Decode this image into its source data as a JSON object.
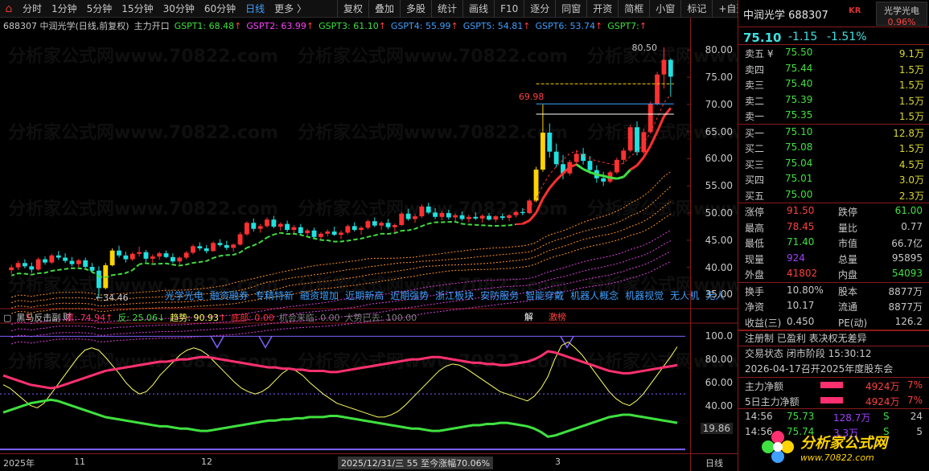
{
  "toolbar": {
    "periods": [
      "分时",
      "1分钟",
      "5分钟",
      "15分钟",
      "30分钟",
      "60分钟",
      "日线",
      "更多 〉"
    ],
    "active_period": "日线",
    "tools": [
      "复权",
      "叠加",
      "多股",
      "统计",
      "画线",
      "F10",
      "逐分",
      "同窗",
      "开资",
      "简框",
      "小窗",
      "标记",
      "+自选",
      "返回"
    ]
  },
  "legend_main": {
    "stock": "688307 中润光学(日线,前复权)",
    "indicator": "主力开口",
    "gspt": [
      {
        "label": "GSPT1: 68.48",
        "color": "#3fe03f",
        "arrow": "↑"
      },
      {
        "label": "GSPT2: 63.99",
        "color": "#ff40ff",
        "arrow": "↑"
      },
      {
        "label": "GSPT3: 61.10",
        "color": "#3fe03f",
        "arrow": "↑"
      },
      {
        "label": "GSPT4: 55.99",
        "color": "#3fa0ff",
        "arrow": "↑"
      },
      {
        "label": "GSPT5: 54.81",
        "color": "#3fa0ff",
        "arrow": "↑"
      },
      {
        "label": "GSPT6: 53.74",
        "color": "#3fa0ff",
        "arrow": "↑"
      },
      {
        "label": "GSPT7:",
        "color": "#3fe03f",
        "arrow": "↑"
      }
    ]
  },
  "legend_sub": {
    "name": "黑马反击副",
    "items": [
      {
        "label": "黑: 74.94",
        "color": "#ff3070",
        "arrow": "↑"
      },
      {
        "label": "反: 25.06",
        "color": "#3fe03f",
        "arrow": "↓"
      },
      {
        "label": "趋势: 90.93",
        "color": "#ffff60",
        "arrow": "↑"
      },
      {
        "label": "底部: 0.00",
        "color": "#ff3030",
        "arrow": ""
      },
      {
        "label": "机会来临: 0.00",
        "color": "#808080",
        "arrow": ""
      },
      {
        "label": "大势已去: 100.00",
        "color": "#808080",
        "arrow": ""
      }
    ]
  },
  "concepts": [
    "光学光电",
    "融资融券",
    "专精特新",
    "融资增加",
    "近期新高",
    "近期强势",
    "浙江板块",
    "安防服务",
    "智能穿戴",
    "机器人概念",
    "机器视觉",
    "无人机",
    "无人"
  ],
  "annotations": {
    "high": "80.50",
    "peak": "69.98",
    "low": "34.46",
    "mark_s": "$",
    "mark_cai": "财",
    "mark_jie": "解",
    "mark_ji": "激榜"
  },
  "y_main": [
    "80.00",
    "75.00",
    "70.00",
    "65.00",
    "60.00",
    "55.00",
    "50.00",
    "45.00",
    "40.00",
    "35.00"
  ],
  "y_sub": [
    "100.0",
    "80.00",
    "60.00",
    "40.00",
    "19.86"
  ],
  "x_labels": [
    {
      "text": "2025年"
    },
    {
      "text": "11"
    },
    {
      "text": "12"
    },
    {
      "text": "2025/12/31/三 55 至今涨幅70.06%"
    },
    {
      "text": "3"
    },
    {
      "text": "日线"
    }
  ],
  "watermark": "分析家公式网www.70822.com",
  "panel": {
    "name": "中润光学",
    "code": "688307",
    "kr": "KR",
    "tag_name": "光学光电",
    "tag_value": "0.96%",
    "price": "75.10",
    "change": "-1.15",
    "pct": "-1.51%",
    "asks": [
      {
        "label": "卖五 ¥",
        "price": "75.50",
        "vol": "9.1万"
      },
      {
        "label": "卖四",
        "price": "75.44",
        "vol": "1.5万"
      },
      {
        "label": "卖三",
        "price": "75.40",
        "vol": "1.5万"
      },
      {
        "label": "卖二",
        "price": "75.39",
        "vol": "1.5万"
      },
      {
        "label": "卖一",
        "price": "75.35",
        "vol": "1.5万"
      }
    ],
    "bids": [
      {
        "label": "买一",
        "price": "75.10",
        "vol": "12.8万"
      },
      {
        "label": "买二",
        "price": "75.08",
        "vol": "1.5万"
      },
      {
        "label": "买三",
        "price": "75.04",
        "vol": "4.5万"
      },
      {
        "label": "买四",
        "price": "75.01",
        "vol": "3.0万"
      },
      {
        "label": "买五",
        "price": "75.00",
        "vol": "2.3万"
      }
    ],
    "stats1": [
      {
        "k1": "涨停",
        "v1": "91.50",
        "c1": "#ff4040",
        "k2": "跌停",
        "v2": "61.00",
        "c2": "#3fe03f"
      },
      {
        "k1": "最高",
        "v1": "78.45",
        "c1": "#ff4040",
        "k2": "量比",
        "v2": "0.77",
        "c2": "#c8c8c8"
      },
      {
        "k1": "最低",
        "v1": "71.40",
        "c1": "#3fe03f",
        "k2": "市值",
        "v2": "66.7亿",
        "c2": "#c8c8c8"
      },
      {
        "k1": "现量",
        "v1": "924",
        "c1": "#a040ff",
        "k2": "总量",
        "v2": "95895",
        "c2": "#c8c8c8"
      },
      {
        "k1": "外盘",
        "v1": "41802",
        "c1": "#ff4040",
        "k2": "内盘",
        "v2": "54093",
        "c2": "#3fe03f"
      }
    ],
    "stats2": [
      {
        "k1": "换手",
        "v1": "10.80%",
        "k2": "股本",
        "v2": "8877万"
      },
      {
        "k1": "净资",
        "v1": "10.17",
        "k2": "流通",
        "v2": "8877万"
      },
      {
        "k1": "收益(三)",
        "v1": "0.450",
        "k2": "PE(动)",
        "v2": "126.2"
      }
    ],
    "info": [
      "注册制 已盈利 表决权无差异",
      "交易状态 闭市阶段 15:30:12",
      "2026-04-17召开2025年度股东会"
    ],
    "money": [
      {
        "label": "主力净额",
        "value": "4924万",
        "pct": "7%"
      },
      {
        "label": "5日主力净额",
        "value": "4924万",
        "pct": "7%"
      }
    ],
    "ticks": [
      {
        "time": "14:56",
        "price": "75.73",
        "vol": "128.7万",
        "bs": "S",
        "n": "24"
      },
      {
        "time": "14:56",
        "price": "75.74",
        "vol": "3.3万",
        "bs": "S",
        "n": "5"
      }
    ]
  },
  "logo": {
    "title": "分析家公式网",
    "url": "www.70822.com"
  },
  "colors": {
    "up": "#ff3030",
    "down": "#20e0e0",
    "yellow_bar": "#ffd400",
    "axis": "#8a1a1a",
    "blue": "#3fa0ff"
  },
  "chart_data": {
    "type": "candlestick",
    "ylim": [
      33,
      83
    ],
    "sub_ylim": [
      0,
      110
    ],
    "candles": [
      [
        39.5,
        40.5,
        38.8,
        40.0
      ],
      [
        40.0,
        41.2,
        39.5,
        40.8
      ],
      [
        40.8,
        41.5,
        39.8,
        40.2
      ],
      [
        40.2,
        40.9,
        39.0,
        39.6
      ],
      [
        39.6,
        41.8,
        39.4,
        41.5
      ],
      [
        41.5,
        42.0,
        40.5,
        40.9
      ],
      [
        40.9,
        42.5,
        40.6,
        42.2
      ],
      [
        42.2,
        43.0,
        41.4,
        41.8
      ],
      [
        41.8,
        42.6,
        40.8,
        41.2
      ],
      [
        41.2,
        41.9,
        40.2,
        40.6
      ],
      [
        40.6,
        41.6,
        40.0,
        41.3
      ],
      [
        41.3,
        41.8,
        39.8,
        40.1
      ],
      [
        40.1,
        40.8,
        38.9,
        39.4
      ],
      [
        39.4,
        40.2,
        34.46,
        36.2
      ],
      [
        36.2,
        40.8,
        36.0,
        40.4
      ],
      [
        40.4,
        43.5,
        40.2,
        43.1
      ],
      [
        43.1,
        44.0,
        41.8,
        42.2
      ],
      [
        42.2,
        42.9,
        40.9,
        41.5
      ],
      [
        41.5,
        42.8,
        41.2,
        42.5
      ],
      [
        42.5,
        43.8,
        42.0,
        42.8
      ],
      [
        42.8,
        43.2,
        41.0,
        41.6
      ],
      [
        41.6,
        42.4,
        40.8,
        42.0
      ],
      [
        42.0,
        42.9,
        41.4,
        42.6
      ],
      [
        42.6,
        43.1,
        41.7,
        41.9
      ],
      [
        41.9,
        42.6,
        40.8,
        41.1
      ],
      [
        41.1,
        42.0,
        40.6,
        41.8
      ],
      [
        41.8,
        43.0,
        41.5,
        42.7
      ],
      [
        42.7,
        44.2,
        42.4,
        43.9
      ],
      [
        43.9,
        44.6,
        43.1,
        43.5
      ],
      [
        43.5,
        44.1,
        42.6,
        43.0
      ],
      [
        43.0,
        44.8,
        42.9,
        44.5
      ],
      [
        44.5,
        45.2,
        43.8,
        44.1
      ],
      [
        44.1,
        44.9,
        43.2,
        43.6
      ],
      [
        43.6,
        44.4,
        42.9,
        44.2
      ],
      [
        44.2,
        46.5,
        44.0,
        46.1
      ],
      [
        46.1,
        48.5,
        45.8,
        48.2
      ],
      [
        48.2,
        49.0,
        46.6,
        47.1
      ],
      [
        47.1,
        48.0,
        46.4,
        47.6
      ],
      [
        47.6,
        49.2,
        47.3,
        48.8
      ],
      [
        48.8,
        49.5,
        47.2,
        47.5
      ],
      [
        47.5,
        48.3,
        46.8,
        48.0
      ],
      [
        48.0,
        48.6,
        46.5,
        46.9
      ],
      [
        46.9,
        47.8,
        46.2,
        47.4
      ],
      [
        47.4,
        48.0,
        45.9,
        46.3
      ],
      [
        46.3,
        47.1,
        45.6,
        46.8
      ],
      [
        46.8,
        47.3,
        45.2,
        45.6
      ],
      [
        45.6,
        46.5,
        45.0,
        46.2
      ],
      [
        46.2,
        47.0,
        45.7,
        46.6
      ],
      [
        46.6,
        47.5,
        45.8,
        46.0
      ],
      [
        46.0,
        46.8,
        45.2,
        46.4
      ],
      [
        46.4,
        47.9,
        46.1,
        47.6
      ],
      [
        47.6,
        48.3,
        46.6,
        46.9
      ],
      [
        46.9,
        47.6,
        46.0,
        47.3
      ],
      [
        47.3,
        48.8,
        47.0,
        48.5
      ],
      [
        48.5,
        49.2,
        47.4,
        47.7
      ],
      [
        47.7,
        48.5,
        46.9,
        48.2
      ],
      [
        48.2,
        48.9,
        47.0,
        47.4
      ],
      [
        47.4,
        48.1,
        46.5,
        47.8
      ],
      [
        47.8,
        50.2,
        47.6,
        49.9
      ],
      [
        49.9,
        50.8,
        48.6,
        48.9
      ],
      [
        48.9,
        49.8,
        48.2,
        49.4
      ],
      [
        49.4,
        51.6,
        49.1,
        51.2
      ],
      [
        51.2,
        51.9,
        49.8,
        50.1
      ],
      [
        50.1,
        50.9,
        48.9,
        49.3
      ],
      [
        49.3,
        50.4,
        48.7,
        50.0
      ],
      [
        50.0,
        50.6,
        48.8,
        49.2
      ],
      [
        49.2,
        49.9,
        48.4,
        49.6
      ],
      [
        49.6,
        50.3,
        48.6,
        48.9
      ],
      [
        48.9,
        49.7,
        48.3,
        49.3
      ],
      [
        49.3,
        50.1,
        48.7,
        49.0
      ],
      [
        49.0,
        49.8,
        48.2,
        49.5
      ],
      [
        49.5,
        50.0,
        48.6,
        48.8
      ],
      [
        48.8,
        49.6,
        48.3,
        49.4
      ],
      [
        49.4,
        49.9,
        48.7,
        49.1
      ],
      [
        49.1,
        49.8,
        48.5,
        49.6
      ],
      [
        49.6,
        50.5,
        49.2,
        50.2
      ],
      [
        50.2,
        50.9,
        49.6,
        50.0
      ],
      [
        50.0,
        52.6,
        49.8,
        52.3
      ],
      [
        52.3,
        58.5,
        52.0,
        58.0
      ],
      [
        58.0,
        69.98,
        57.6,
        64.8
      ],
      [
        64.8,
        66.5,
        60.2,
        61.3
      ],
      [
        61.3,
        62.8,
        58.4,
        59.0
      ],
      [
        59.0,
        60.7,
        56.2,
        57.3
      ],
      [
        57.3,
        59.8,
        56.9,
        59.4
      ],
      [
        59.4,
        61.6,
        58.8,
        60.9
      ],
      [
        60.9,
        62.0,
        58.9,
        59.6
      ],
      [
        59.6,
        60.5,
        57.2,
        57.9
      ],
      [
        57.9,
        58.8,
        55.6,
        56.4
      ],
      [
        56.4,
        57.6,
        55.0,
        55.8
      ],
      [
        55.8,
        57.8,
        55.5,
        57.5
      ],
      [
        57.5,
        60.2,
        57.2,
        59.8
      ],
      [
        59.8,
        62.0,
        59.1,
        61.5
      ],
      [
        61.5,
        66.2,
        61.2,
        65.8
      ],
      [
        65.8,
        66.9,
        60.6,
        61.2
      ],
      [
        61.2,
        65.5,
        60.9,
        64.9
      ],
      [
        64.9,
        70.5,
        64.6,
        70.1
      ],
      [
        70.1,
        76.0,
        69.8,
        75.5
      ],
      [
        75.5,
        80.5,
        72.9,
        78.2
      ],
      [
        78.2,
        78.45,
        71.4,
        75.1
      ]
    ],
    "sub_series": {
      "hei": [
        66,
        64,
        62,
        60,
        58,
        57,
        56,
        55,
        56,
        58,
        60,
        62,
        64,
        66,
        68,
        70,
        71,
        72,
        73,
        74,
        75,
        76,
        77,
        78,
        78,
        79,
        80,
        80,
        81,
        82,
        82,
        81,
        80,
        79,
        78,
        77,
        76,
        75,
        74,
        73,
        73,
        72,
        72,
        71,
        71,
        70,
        70,
        70,
        69,
        69,
        70,
        71,
        72,
        73,
        74,
        75,
        76,
        77,
        78,
        79,
        80,
        80,
        81,
        82,
        82,
        81,
        80,
        79,
        78,
        77,
        77,
        76,
        76,
        75,
        75,
        76,
        77,
        78,
        80,
        83,
        87,
        86,
        84,
        82,
        80,
        78,
        76,
        74,
        72,
        70,
        69,
        68,
        68,
        69,
        70,
        71,
        72,
        73,
        74,
        75
      ],
      "fan": [
        34,
        36,
        38,
        40,
        42,
        43,
        44,
        45,
        44,
        42,
        40,
        38,
        36,
        34,
        32,
        30,
        29,
        28,
        27,
        26,
        25,
        24,
        23,
        22,
        22,
        21,
        20,
        20,
        19,
        18,
        18,
        19,
        20,
        21,
        22,
        23,
        24,
        25,
        26,
        27,
        27,
        28,
        28,
        29,
        29,
        30,
        30,
        30,
        31,
        31,
        30,
        29,
        28,
        27,
        26,
        25,
        24,
        23,
        22,
        21,
        20,
        20,
        19,
        18,
        18,
        19,
        20,
        21,
        22,
        23,
        23,
        24,
        24,
        25,
        25,
        24,
        23,
        22,
        20,
        17,
        13,
        14,
        16,
        18,
        20,
        22,
        24,
        26,
        28,
        30,
        31,
        32,
        32,
        31,
        30,
        29,
        28,
        27,
        26,
        25
      ],
      "qushi": [
        58,
        55,
        50,
        45,
        40,
        38,
        42,
        50,
        58,
        66,
        74,
        82,
        88,
        90,
        88,
        82,
        75,
        68,
        60,
        54,
        50,
        52,
        58,
        66,
        72,
        78,
        84,
        88,
        90,
        88,
        84,
        78,
        72,
        66,
        60,
        55,
        52,
        50,
        52,
        56,
        62,
        68,
        72,
        70,
        66,
        60,
        55,
        50,
        46,
        42,
        40,
        38,
        36,
        34,
        32,
        30,
        30,
        32,
        35,
        40,
        46,
        52,
        58,
        64,
        70,
        74,
        76,
        75,
        72,
        68,
        64,
        60,
        56,
        52,
        50,
        48,
        46,
        44,
        48,
        55,
        65,
        80,
        92,
        95,
        90,
        84,
        76,
        68,
        60,
        52,
        46,
        42,
        40,
        44,
        50,
        58,
        66,
        74,
        82,
        90.93
      ]
    }
  }
}
